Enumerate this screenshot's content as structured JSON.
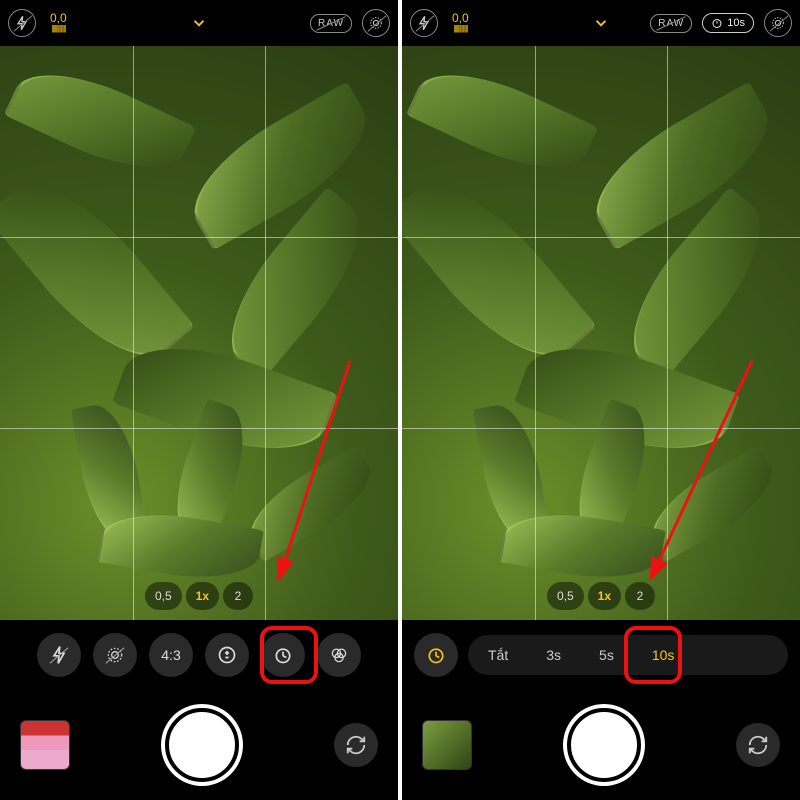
{
  "left": {
    "top": {
      "exposure_value": "0,0",
      "raw_label": "RAW"
    },
    "zoom": {
      "z1": "0,5",
      "z2": "1x",
      "z3": "2"
    },
    "controls": {
      "aspect": "4:3"
    }
  },
  "right": {
    "top": {
      "exposure_value": "0,0",
      "raw_label": "RAW",
      "timer_label": "10s"
    },
    "zoom": {
      "z1": "0,5",
      "z2": "1x",
      "z3": "2"
    },
    "timer_options": {
      "off": "Tắt",
      "t3": "3s",
      "t5": "5s",
      "t10": "10s"
    }
  }
}
